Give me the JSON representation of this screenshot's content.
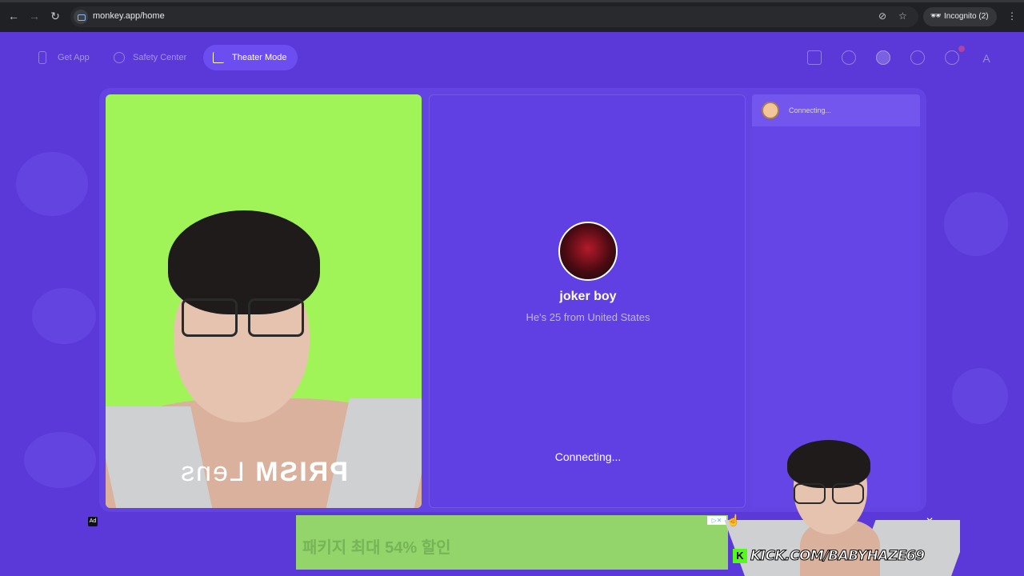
{
  "browser": {
    "url": "monkey.app/home",
    "incognito_label": "Incognito (2)"
  },
  "topnav": {
    "get_app": "Get App",
    "safety_center": "Safety Center",
    "theater_mode": "Theater Mode"
  },
  "self_video": {
    "overlay_brand": "PRISM",
    "overlay_sub": "Lens"
  },
  "stranger": {
    "name": "joker boy",
    "info": "He's 25 from United States",
    "status": "Connecting..."
  },
  "chat": {
    "status": "Connecting..."
  },
  "ad": {
    "label": "Ad",
    "text": "패키지 최대 54% 할인",
    "choices": "▷✕",
    "close": "✕"
  },
  "stream_overlay": {
    "kick_logo": "K",
    "kick_text": "KICK.COM/BABYHAZE69"
  },
  "colors": {
    "page_bg": "#5a39d8",
    "self_video_bg": "#a1f458",
    "kick_green": "#53fc18"
  }
}
